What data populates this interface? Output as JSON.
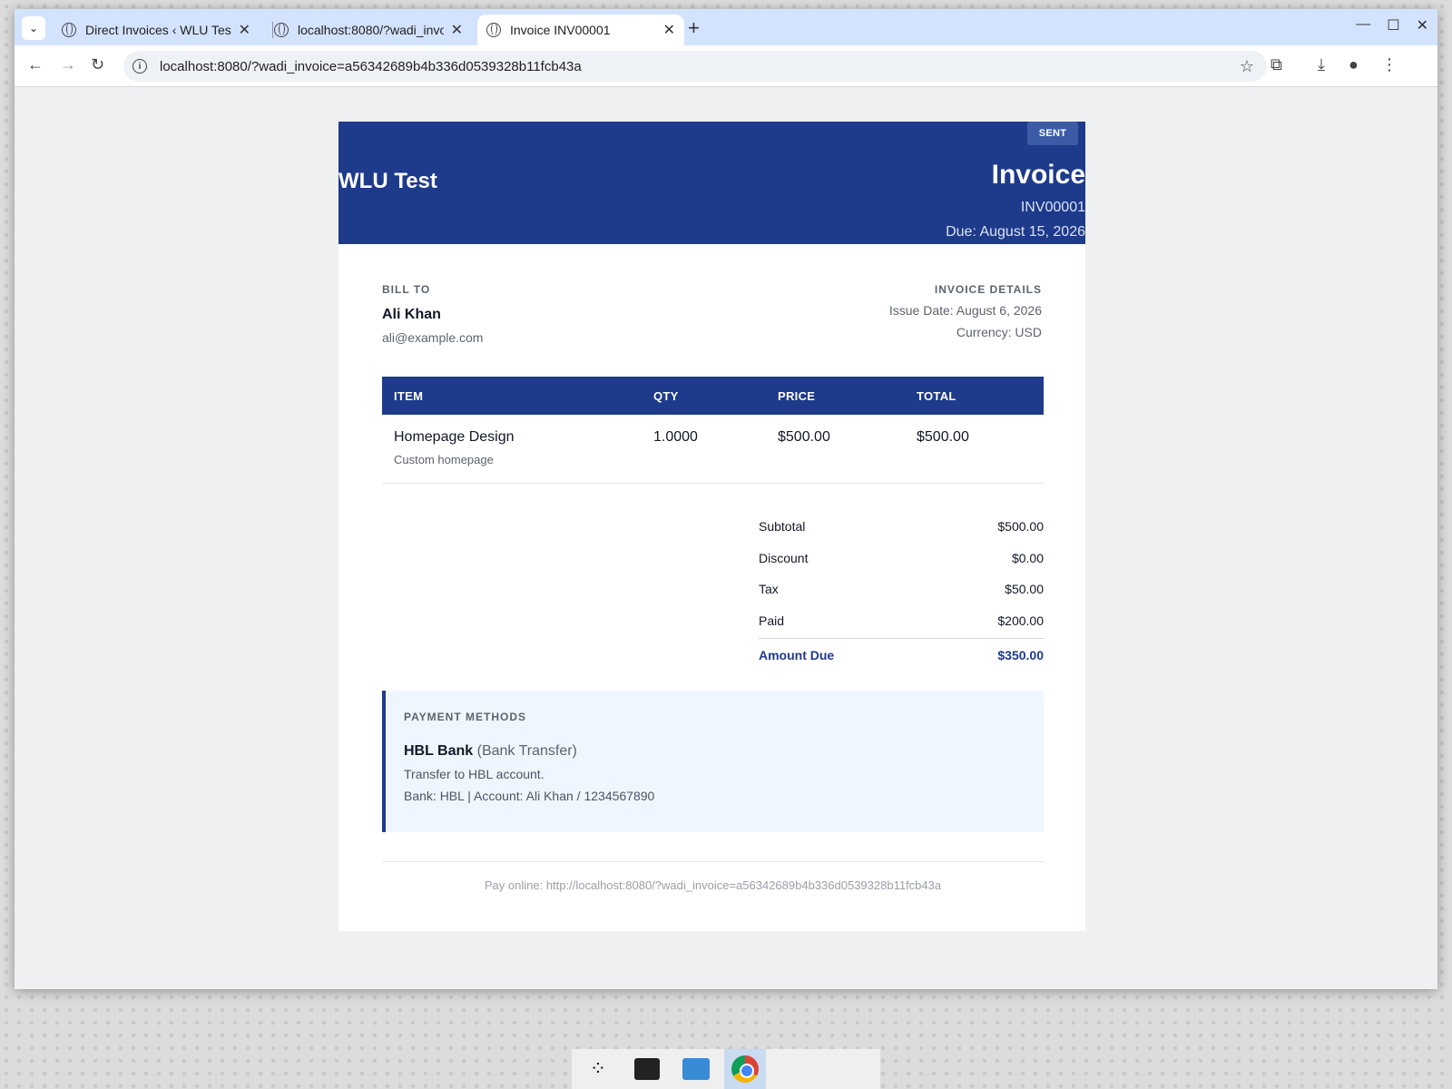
{
  "browser": {
    "tabs": [
      {
        "title": "Direct Invoices ‹ WLU Test",
        "active": false
      },
      {
        "title": "localhost:8080/?wadi_invoice",
        "active": false
      },
      {
        "title": "Invoice INV00001",
        "active": true
      }
    ],
    "url": "localhost:8080/?wadi_invoice=a56342689b4b336d0539328b11fcb43a"
  },
  "invoice": {
    "company": "WLU Test",
    "status": "SENT",
    "title": "Invoice",
    "number": "INV00001",
    "due": "Due: August 15, 2026",
    "bill_to": {
      "label": "BILL TO",
      "name": "Ali Khan",
      "email": "ali@example.com"
    },
    "details": {
      "label": "INVOICE DETAILS",
      "issue_date": "Issue Date: August 6, 2026",
      "currency": "Currency: USD"
    },
    "table": {
      "headers": [
        "ITEM",
        "QTY",
        "PRICE",
        "TOTAL"
      ],
      "rows": [
        {
          "item": "Homepage Design",
          "desc": "Custom homepage",
          "qty": "1.0000",
          "price": "$500.00",
          "total": "$500.00"
        }
      ]
    },
    "totals": [
      {
        "label": "Subtotal",
        "value": "$500.00"
      },
      {
        "label": "Discount",
        "value": "$0.00"
      },
      {
        "label": "Tax",
        "value": "$50.00"
      },
      {
        "label": "Paid",
        "value": "$200.00"
      }
    ],
    "amount_due": {
      "label": "Amount Due",
      "value": "$350.00"
    },
    "payment": {
      "label": "PAYMENT METHODS",
      "name": "HBL Bank",
      "type": "(Bank Transfer)",
      "line1": "Transfer to HBL account.",
      "line2": "Bank: HBL | Account: Ali Khan / 1234567890"
    },
    "pay_online": "Pay online: http://localhost:8080/?wadi_invoice=a56342689b4b336d0539328b11fcb43a"
  },
  "colors": {
    "brand": "#1e3a8a",
    "badge": "#3b5ba5",
    "payment_bg": "#eff6ff"
  }
}
